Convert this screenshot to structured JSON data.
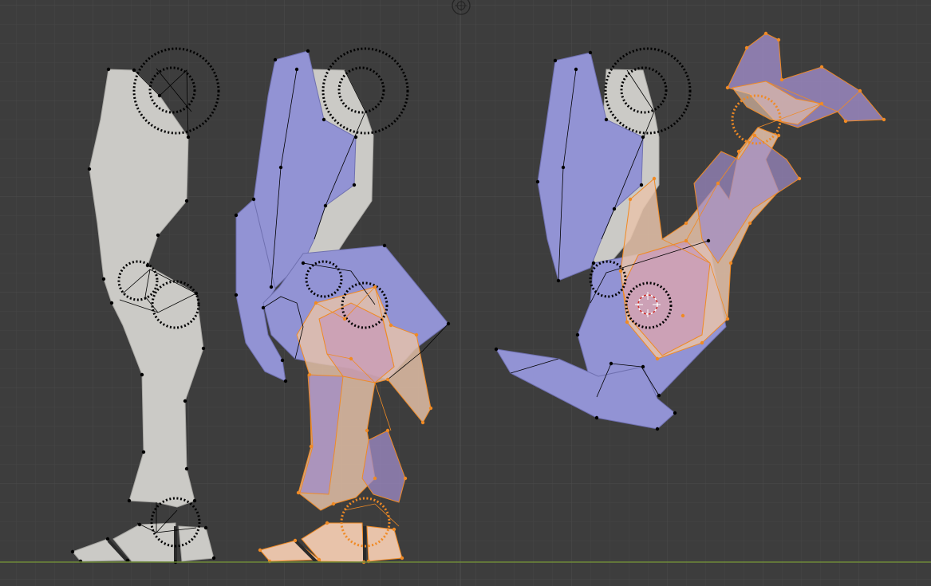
{
  "viewport": {
    "name": "3d-viewport-edit-mode",
    "background": "#3d3d3d",
    "grid_minor": "#444444",
    "grid_major": "#4a4a4a",
    "ground_axis": "#6e8a3a"
  },
  "colors": {
    "unselected_fill": "#cbcac6",
    "unselected_stroke": "#a9a8a4",
    "inactive_face": "#9293d4",
    "selected_face": "#e8c3aa",
    "selected_overlay": "#c592b8",
    "selected_edge": "#f08a24",
    "vertex_unselected": "#000000",
    "vertex_selected": "#f08a24"
  },
  "figures": [
    {
      "name": "leg-rest-pose",
      "state": "unselected"
    },
    {
      "name": "leg-standing-pose",
      "state": "partially-selected"
    },
    {
      "name": "leg-kneeling-pose",
      "state": "partially-selected"
    }
  ],
  "icons": {
    "top_gizmo": "navigation-gizmo-icon",
    "cursor": "3d-cursor-icon"
  }
}
